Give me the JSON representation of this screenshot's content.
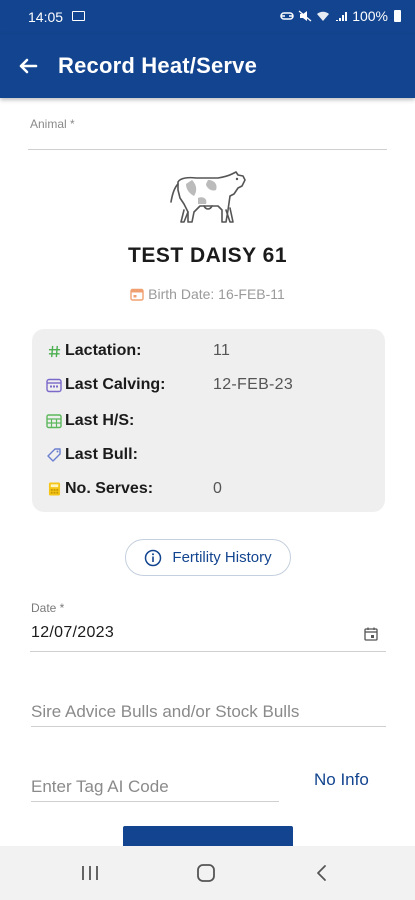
{
  "status_bar": {
    "time": "14:05",
    "battery": "100%"
  },
  "app_bar": {
    "title": "Record Heat/Serve"
  },
  "animal_field": {
    "label": "Animal *"
  },
  "animal": {
    "name": "TEST DAISY 61",
    "birth_date": "Birth Date: 16-FEB-11"
  },
  "info_card": {
    "rows": [
      {
        "label": "Lactation:",
        "value": "11",
        "icon": "hash-icon",
        "icon_color": "#4caf50"
      },
      {
        "label": "Last Calving:",
        "value": "12-FEB-23",
        "icon": "calendar-icon",
        "icon_color": "#7b68c9"
      },
      {
        "label": "Last H/S:",
        "value": "",
        "icon": "calendar-grid-icon",
        "icon_color": "#5cb85c"
      },
      {
        "label": "Last Bull:",
        "value": "",
        "icon": "tag-icon",
        "icon_color": "#6b7fd0"
      },
      {
        "label": "No. Serves:",
        "value": "0",
        "icon": "calculator-icon",
        "icon_color": "#f5c518"
      }
    ]
  },
  "fertility_button": {
    "label": "Fertility History"
  },
  "date_field": {
    "label": "Date *",
    "value": "12/07/2023"
  },
  "sire_field": {
    "placeholder": "Sire Advice Bulls and/or Stock Bulls"
  },
  "tag_field": {
    "placeholder": "Enter Tag AI Code",
    "no_info_label": "No Info"
  },
  "colors": {
    "primary": "#13448f",
    "birth_calendar": "#f0a070"
  }
}
